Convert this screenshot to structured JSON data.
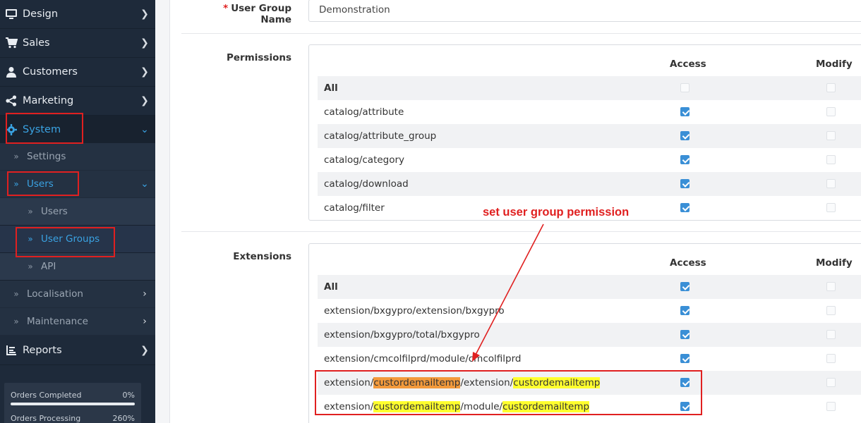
{
  "sidebar": {
    "menu": [
      {
        "label": "Design",
        "icon": "monitor-icon"
      },
      {
        "label": "Sales",
        "icon": "cart-icon"
      },
      {
        "label": "Customers",
        "icon": "user-icon"
      },
      {
        "label": "Marketing",
        "icon": "share-icon"
      },
      {
        "label": "System",
        "icon": "gear-icon"
      }
    ],
    "system_sub": [
      {
        "label": "Settings"
      },
      {
        "label": "Users"
      },
      {
        "label": "Users"
      },
      {
        "label": "User Groups"
      },
      {
        "label": "API"
      },
      {
        "label": "Localisation"
      },
      {
        "label": "Maintenance"
      }
    ],
    "reports": {
      "label": "Reports",
      "icon": "bar-chart-icon"
    },
    "stats": [
      {
        "label": "Orders Completed",
        "value": "0%",
        "progress": 0
      },
      {
        "label": "Orders Processing",
        "value": "260%",
        "progress": 100
      }
    ]
  },
  "form": {
    "user_group_name": {
      "required_mark": "*",
      "label": "User Group Name",
      "value": "Demonstration"
    },
    "permissions": {
      "label": "Permissions",
      "col_access": "Access",
      "col_modify": "Modify",
      "rows": [
        {
          "name": "All",
          "access": false,
          "modify": false
        },
        {
          "name": "catalog/attribute",
          "access": true,
          "modify": false
        },
        {
          "name": "catalog/attribute_group",
          "access": true,
          "modify": false
        },
        {
          "name": "catalog/category",
          "access": true,
          "modify": false
        },
        {
          "name": "catalog/download",
          "access": true,
          "modify": false
        },
        {
          "name": "catalog/filter",
          "access": true,
          "modify": false
        }
      ]
    },
    "extensions": {
      "label": "Extensions",
      "col_access": "Access",
      "col_modify": "Modify",
      "rows": [
        {
          "name": "All",
          "access": true,
          "modify": false
        },
        {
          "name": "extension/bxgypro/extension/bxgypro",
          "access": true,
          "modify": false
        },
        {
          "name": "extension/bxgypro/total/bxgypro",
          "access": true,
          "modify": false
        },
        {
          "name": "extension/cmcolfilprd/module/cmcolfilprd",
          "access": true,
          "modify": false
        },
        {
          "name_parts": [
            "extension/",
            "custordemailtemp",
            "/extension/",
            "custordemailtemp"
          ],
          "access": true,
          "modify": false
        },
        {
          "name_parts": [
            "extension/",
            "custordemailtemp",
            "/module/",
            "custordemailtemp"
          ],
          "access": true,
          "modify": false
        }
      ]
    }
  },
  "annotation": {
    "text": "set user group permission",
    "color": "#e02020"
  },
  "colors": {
    "sidebar_bg": "#1e2a3a",
    "accent": "#3aa3e3",
    "highlight_orange": "#f39a3c",
    "highlight_yellow": "#ffff2e",
    "annotation_red": "#e02020"
  }
}
